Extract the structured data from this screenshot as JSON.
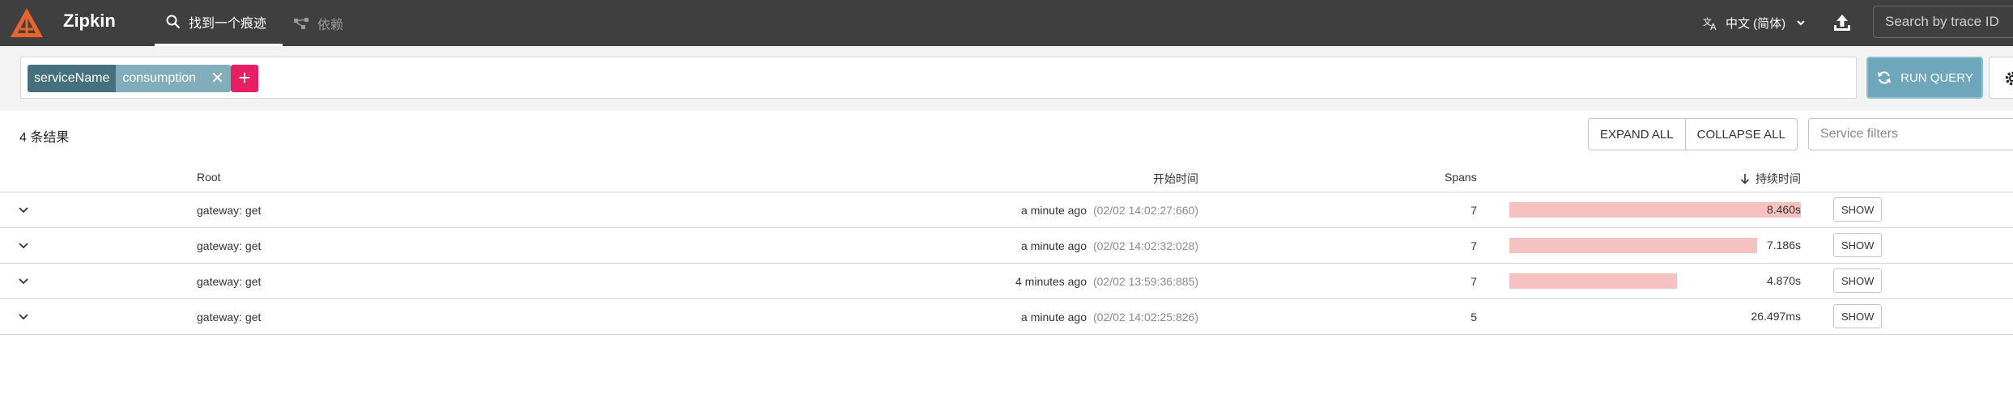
{
  "app": {
    "brand": "Zipkin",
    "nav": [
      {
        "label": "找到一个痕迹",
        "active": true
      },
      {
        "label": "依赖",
        "active": false
      }
    ],
    "language": "中文 (简体)",
    "trace_search_placeholder": "Search by trace ID"
  },
  "query": {
    "chips": [
      {
        "key": "serviceName",
        "value": "consumption"
      }
    ],
    "add_label": "+",
    "run_label": "RUN QUERY"
  },
  "results": {
    "count_label": "4 条结果",
    "expand_all": "EXPAND ALL",
    "collapse_all": "COLLAPSE ALL",
    "service_filter_placeholder": "Service filters",
    "columns": {
      "root": "Root",
      "start": "开始时间",
      "spans": "Spans",
      "duration": "持续时间"
    },
    "show_label": "SHOW",
    "rows": [
      {
        "root": "gateway: get",
        "start_rel": "a minute ago",
        "start_abs": "(02/02 14:02:27:660)",
        "spans": "7",
        "duration": "8.460s",
        "bar_fraction": 1.0
      },
      {
        "root": "gateway: get",
        "start_rel": "a minute ago",
        "start_abs": "(02/02 14:02:32:028)",
        "spans": "7",
        "duration": "7.186s",
        "bar_fraction": 0.849
      },
      {
        "root": "gateway: get",
        "start_rel": "4 minutes ago",
        "start_abs": "(02/02 13:59:36:885)",
        "spans": "7",
        "duration": "4.870s",
        "bar_fraction": 0.576
      },
      {
        "root": "gateway: get",
        "start_rel": "a minute ago",
        "start_abs": "(02/02 14:02:25:826)",
        "spans": "5",
        "duration": "26.497ms",
        "bar_fraction": 0.0
      }
    ]
  },
  "colors": {
    "topbar": "#3f3f3f",
    "accent": "#e91e63",
    "chip_key": "#46707d",
    "chip_value": "#82aebb",
    "run_button": "#6ea6bc",
    "duration_bar": "#f6c1c1"
  }
}
